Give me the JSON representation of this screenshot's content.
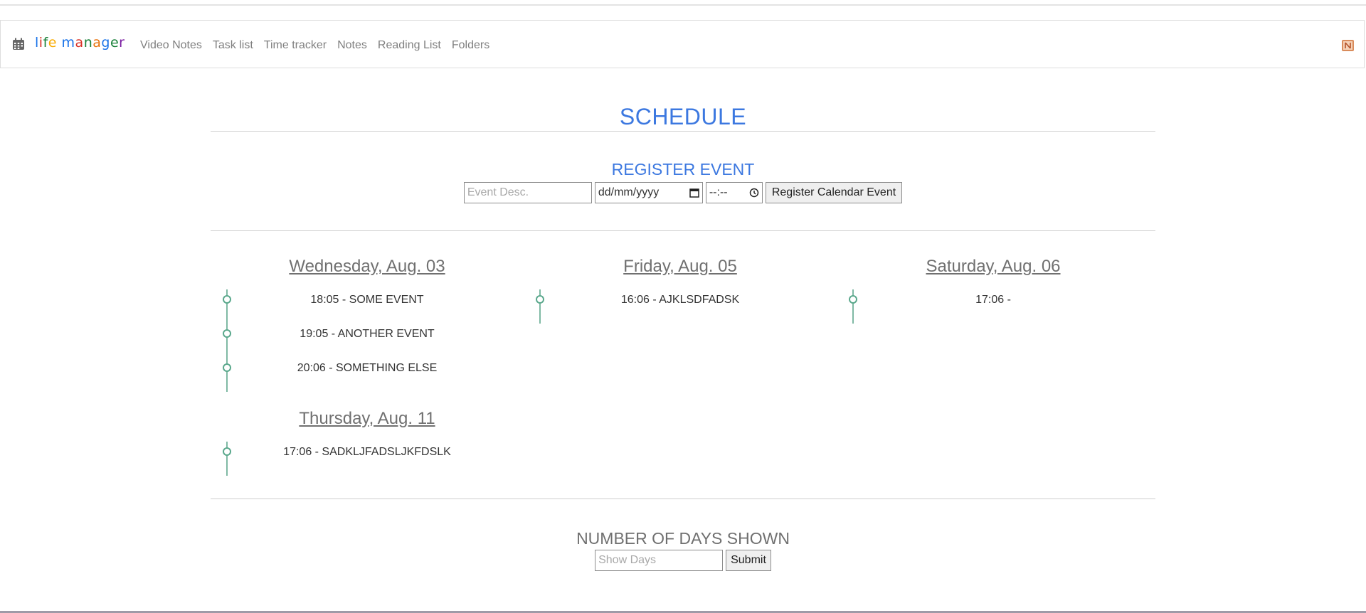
{
  "nav": {
    "brand_letters": [
      {
        "char": "l",
        "color": "#1a73e8"
      },
      {
        "char": "i",
        "color": "#d93025"
      },
      {
        "char": "f",
        "color": "#188038"
      },
      {
        "char": "e",
        "color": "#f9ab00"
      },
      {
        "char": " ",
        "color": "#333333"
      },
      {
        "char": "m",
        "color": "#1a73e8"
      },
      {
        "char": "a",
        "color": "#d93025"
      },
      {
        "char": "n",
        "color": "#188038"
      },
      {
        "char": "a",
        "color": "#e8710a"
      },
      {
        "char": "g",
        "color": "#1a73e8"
      },
      {
        "char": "e",
        "color": "#188038"
      },
      {
        "char": "r",
        "color": "#7b1fa2"
      }
    ],
    "links": [
      "Video Notes",
      "Task list",
      "Time tracker",
      "Notes",
      "Reading List",
      "Folders"
    ],
    "left_icon": "calendar-icon",
    "right_icon": "notion-icon"
  },
  "page": {
    "title": "SCHEDULE",
    "accent_color": "#3c78e0"
  },
  "register": {
    "title": "REGISTER EVENT",
    "desc_placeholder": "Event Desc.",
    "date_placeholder": "dd/mm/yyyy",
    "time_placeholder": "--:--",
    "submit_label": "Register Calendar Event"
  },
  "days": [
    {
      "title": "Wednesday, Aug. 03",
      "events": [
        "18:05 - SOME EVENT",
        "19:05 - ANOTHER EVENT",
        "20:06 - SOMETHING ELSE"
      ]
    },
    {
      "title": "Friday, Aug. 05",
      "events": [
        "16:06 - AJKLSDFADSK"
      ]
    },
    {
      "title": "Saturday, Aug. 06",
      "events": [
        "17:06 -"
      ]
    },
    {
      "title": "Thursday, Aug. 11",
      "events": [
        "17:06 - SADKLJFADSLJKFDSLK"
      ]
    }
  ],
  "days_shown": {
    "title": "NUMBER OF DAYS SHOWN",
    "placeholder": "Show Days",
    "submit_label": "Submit"
  }
}
